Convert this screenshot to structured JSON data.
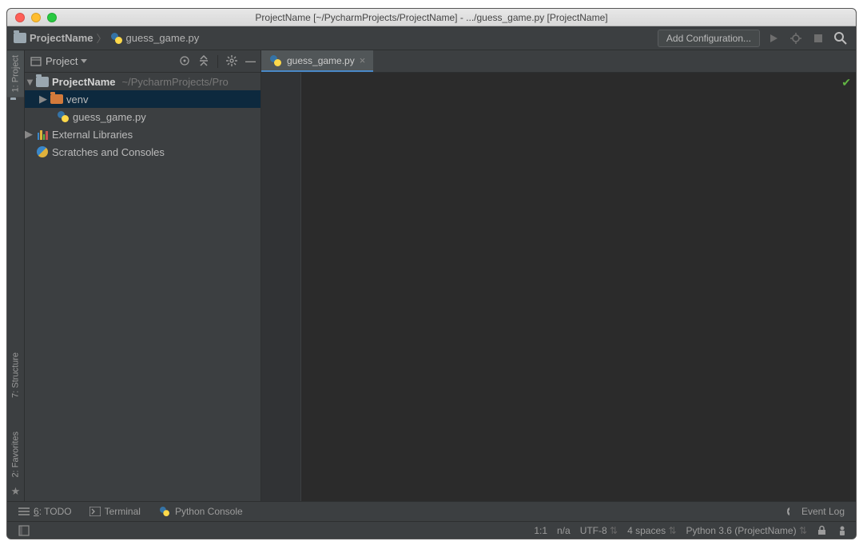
{
  "title": "ProjectName [~/PycharmProjects/ProjectName] - .../guess_game.py [ProjectName]",
  "breadcrumb": {
    "project": "ProjectName",
    "file": "guess_game.py"
  },
  "nav": {
    "add_config": "Add Configuration..."
  },
  "sidebar": {
    "view_label": "Project",
    "tree": {
      "root_name": "ProjectName",
      "root_path": "~/PycharmProjects/Pro",
      "venv": "venv",
      "file": "guess_game.py",
      "external": "External Libraries",
      "scratches": "Scratches and Consoles"
    }
  },
  "left_tools": {
    "project": "1: Project",
    "structure": "7: Structure",
    "favorites": "2: Favorites"
  },
  "editor": {
    "tab": "guess_game.py"
  },
  "bottom_tools": {
    "todo": "6: TODO",
    "terminal": "Terminal",
    "pyconsole": "Python Console",
    "eventlog": "Event Log"
  },
  "status": {
    "pos": "1:1",
    "readonly": "n/a",
    "encoding": "UTF-8",
    "indent": "4 spaces",
    "interpreter": "Python 3.6 (ProjectName)"
  }
}
